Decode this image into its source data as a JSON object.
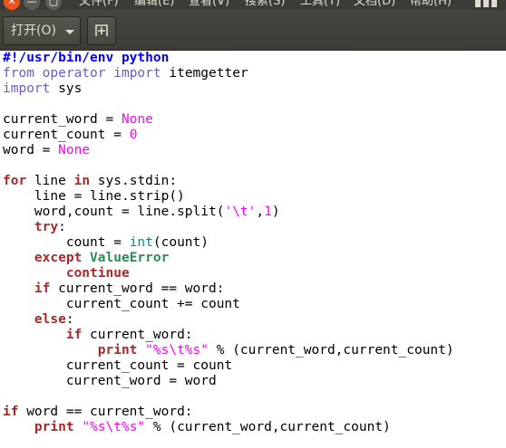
{
  "window": {
    "close_glyph": "✕",
    "min_glyph": "—",
    "max_glyph": "▢"
  },
  "menubar": {
    "items": [
      "文件(F)",
      "编辑(E)",
      "查看(V)",
      "搜索(S)",
      "工具(T)",
      "文档(D)",
      "帮助(H)"
    ]
  },
  "toolbar": {
    "open_label": "打开(O)",
    "open_icon": "chevron-down-icon",
    "new_tab_icon": "new-document-icon"
  },
  "colors": {
    "accent": "#e95420",
    "keyword": "#a52a2a",
    "string": "#ff00ff",
    "builtin": "#008b8b",
    "module": "#6a5acd",
    "shebang": "#0000ff",
    "exception": "#2e8b57"
  },
  "code": {
    "lines": [
      [
        {
          "t": "#!/usr/bin/env python",
          "c": "cmt"
        }
      ],
      [
        {
          "t": "from",
          "c": "pur"
        },
        {
          "t": " "
        },
        {
          "t": "operator",
          "c": "pur"
        },
        {
          "t": " "
        },
        {
          "t": "import",
          "c": "pur"
        },
        {
          "t": " itemgetter"
        }
      ],
      [
        {
          "t": "import",
          "c": "pur"
        },
        {
          "t": " sys"
        }
      ],
      [],
      [
        {
          "t": "current_word = "
        },
        {
          "t": "None",
          "c": "mag"
        }
      ],
      [
        {
          "t": "current_count = "
        },
        {
          "t": "0",
          "c": "mag"
        }
      ],
      [
        {
          "t": "word = "
        },
        {
          "t": "None",
          "c": "mag"
        }
      ],
      [],
      [
        {
          "t": "for",
          "c": "kw"
        },
        {
          "t": " line "
        },
        {
          "t": "in",
          "c": "kw"
        },
        {
          "t": " sys.stdin:"
        }
      ],
      [
        {
          "t": "    line = line.strip()"
        }
      ],
      [
        {
          "t": "    word,count = line.split("
        },
        {
          "t": "'\\t'",
          "c": "str"
        },
        {
          "t": ","
        },
        {
          "t": "1",
          "c": "mag"
        },
        {
          "t": ")"
        }
      ],
      [
        {
          "t": "    "
        },
        {
          "t": "try",
          "c": "kw"
        },
        {
          "t": ":"
        }
      ],
      [
        {
          "t": "        count = "
        },
        {
          "t": "int",
          "c": "bi"
        },
        {
          "t": "(count)"
        }
      ],
      [
        {
          "t": "    "
        },
        {
          "t": "except",
          "c": "kw"
        },
        {
          "t": " "
        },
        {
          "t": "ValueError",
          "c": "exc"
        }
      ],
      [
        {
          "t": "        "
        },
        {
          "t": "continue",
          "c": "kw"
        }
      ],
      [
        {
          "t": "    "
        },
        {
          "t": "if",
          "c": "kw"
        },
        {
          "t": " current_word == word:"
        }
      ],
      [
        {
          "t": "        current_count += count"
        }
      ],
      [
        {
          "t": "    "
        },
        {
          "t": "else",
          "c": "kw"
        },
        {
          "t": ":"
        }
      ],
      [
        {
          "t": "        "
        },
        {
          "t": "if",
          "c": "kw"
        },
        {
          "t": " current_word:"
        }
      ],
      [
        {
          "t": "            "
        },
        {
          "t": "print",
          "c": "kw"
        },
        {
          "t": " "
        },
        {
          "t": "\"%s\\t%s\"",
          "c": "str"
        },
        {
          "t": " % (current_word,current_count)"
        }
      ],
      [
        {
          "t": "        current_count = count"
        }
      ],
      [
        {
          "t": "        current_word = word"
        }
      ],
      [],
      [
        {
          "t": "if",
          "c": "kw"
        },
        {
          "t": " word == current_word:"
        }
      ],
      [
        {
          "t": "    "
        },
        {
          "t": "print",
          "c": "kw"
        },
        {
          "t": " "
        },
        {
          "t": "\"%s\\t%s\"",
          "c": "str"
        },
        {
          "t": " % (current_word,current_count)"
        }
      ]
    ]
  }
}
